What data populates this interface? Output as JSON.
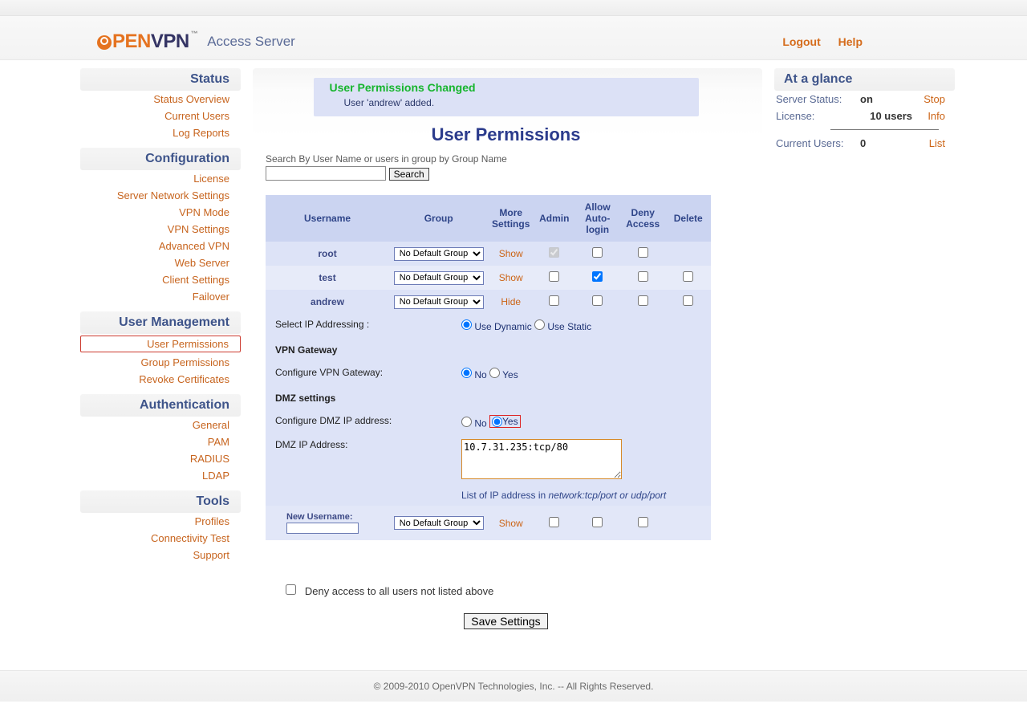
{
  "brand": {
    "prefix": "PEN",
    "suffix": "VPN",
    "tm": "™",
    "subtitle": "Access Server"
  },
  "header_links": {
    "logout": "Logout",
    "help": "Help"
  },
  "nav": {
    "status": {
      "head": "Status",
      "items": [
        "Status Overview",
        "Current Users",
        "Log Reports"
      ]
    },
    "config": {
      "head": "Configuration",
      "items": [
        "License",
        "Server Network Settings",
        "VPN Mode",
        "VPN Settings",
        "Advanced VPN",
        "Web Server",
        "Client Settings",
        "Failover"
      ]
    },
    "usermgmt": {
      "head": "User Management",
      "items": [
        "User Permissions",
        "Group Permissions",
        "Revoke Certificates"
      ],
      "selected_index": 0
    },
    "auth": {
      "head": "Authentication",
      "items": [
        "General",
        "PAM",
        "RADIUS",
        "LDAP"
      ]
    },
    "tools": {
      "head": "Tools",
      "items": [
        "Profiles",
        "Connectivity Test",
        "Support"
      ]
    }
  },
  "notice": {
    "title": "User Permissions Changed",
    "msg": "User 'andrew' added."
  },
  "page_title": "User Permissions",
  "search": {
    "label": "Search By User Name or users in group by Group Name",
    "button": "Search"
  },
  "table": {
    "headers": {
      "username": "Username",
      "group": "Group",
      "more": "More Settings",
      "admin": "Admin",
      "auto": "Allow Auto-login",
      "deny": "Deny Access",
      "delete": "Delete"
    },
    "group_default": "No Default Group",
    "rows": [
      {
        "username": "root",
        "more": "Show",
        "admin": true,
        "admin_disabled": true,
        "auto": false,
        "deny": false,
        "has_delete": false
      },
      {
        "username": "test",
        "more": "Show",
        "admin": false,
        "auto": true,
        "deny": false,
        "has_delete": true
      },
      {
        "username": "andrew",
        "more": "Hide",
        "admin": false,
        "auto": false,
        "deny": false,
        "has_delete": true
      }
    ]
  },
  "detail": {
    "ip_label": "Select IP Addressing :",
    "ip_dynamic": "Use Dynamic",
    "ip_static": "Use Static",
    "gateway_hdr": "VPN Gateway",
    "gateway_label": "Configure VPN Gateway:",
    "dmz_hdr": "DMZ settings",
    "dmz_cfg_label": "Configure DMZ IP address:",
    "dmz_ip_label": "DMZ IP Address:",
    "dmz_ip_value": "10.7.31.235:tcp/80",
    "no": "No",
    "yes": "Yes",
    "hint_prefix": "List of IP address in ",
    "hint_italic": "network:tcp/port or udp/port"
  },
  "newuser": {
    "label": "New Username:",
    "more": "Show"
  },
  "deny_all": "Deny access to all users not listed above",
  "save": "Save Settings",
  "glance": {
    "head": "At a glance",
    "status_label": "Server Status:",
    "status_val": "on",
    "status_act": "Stop",
    "license_label": "License:",
    "license_val": "10 users",
    "license_act": "Info",
    "users_label": "Current Users:",
    "users_val": "0",
    "users_act": "List"
  },
  "footer": "© 2009-2010 OpenVPN Technologies, Inc. -- All Rights Reserved."
}
